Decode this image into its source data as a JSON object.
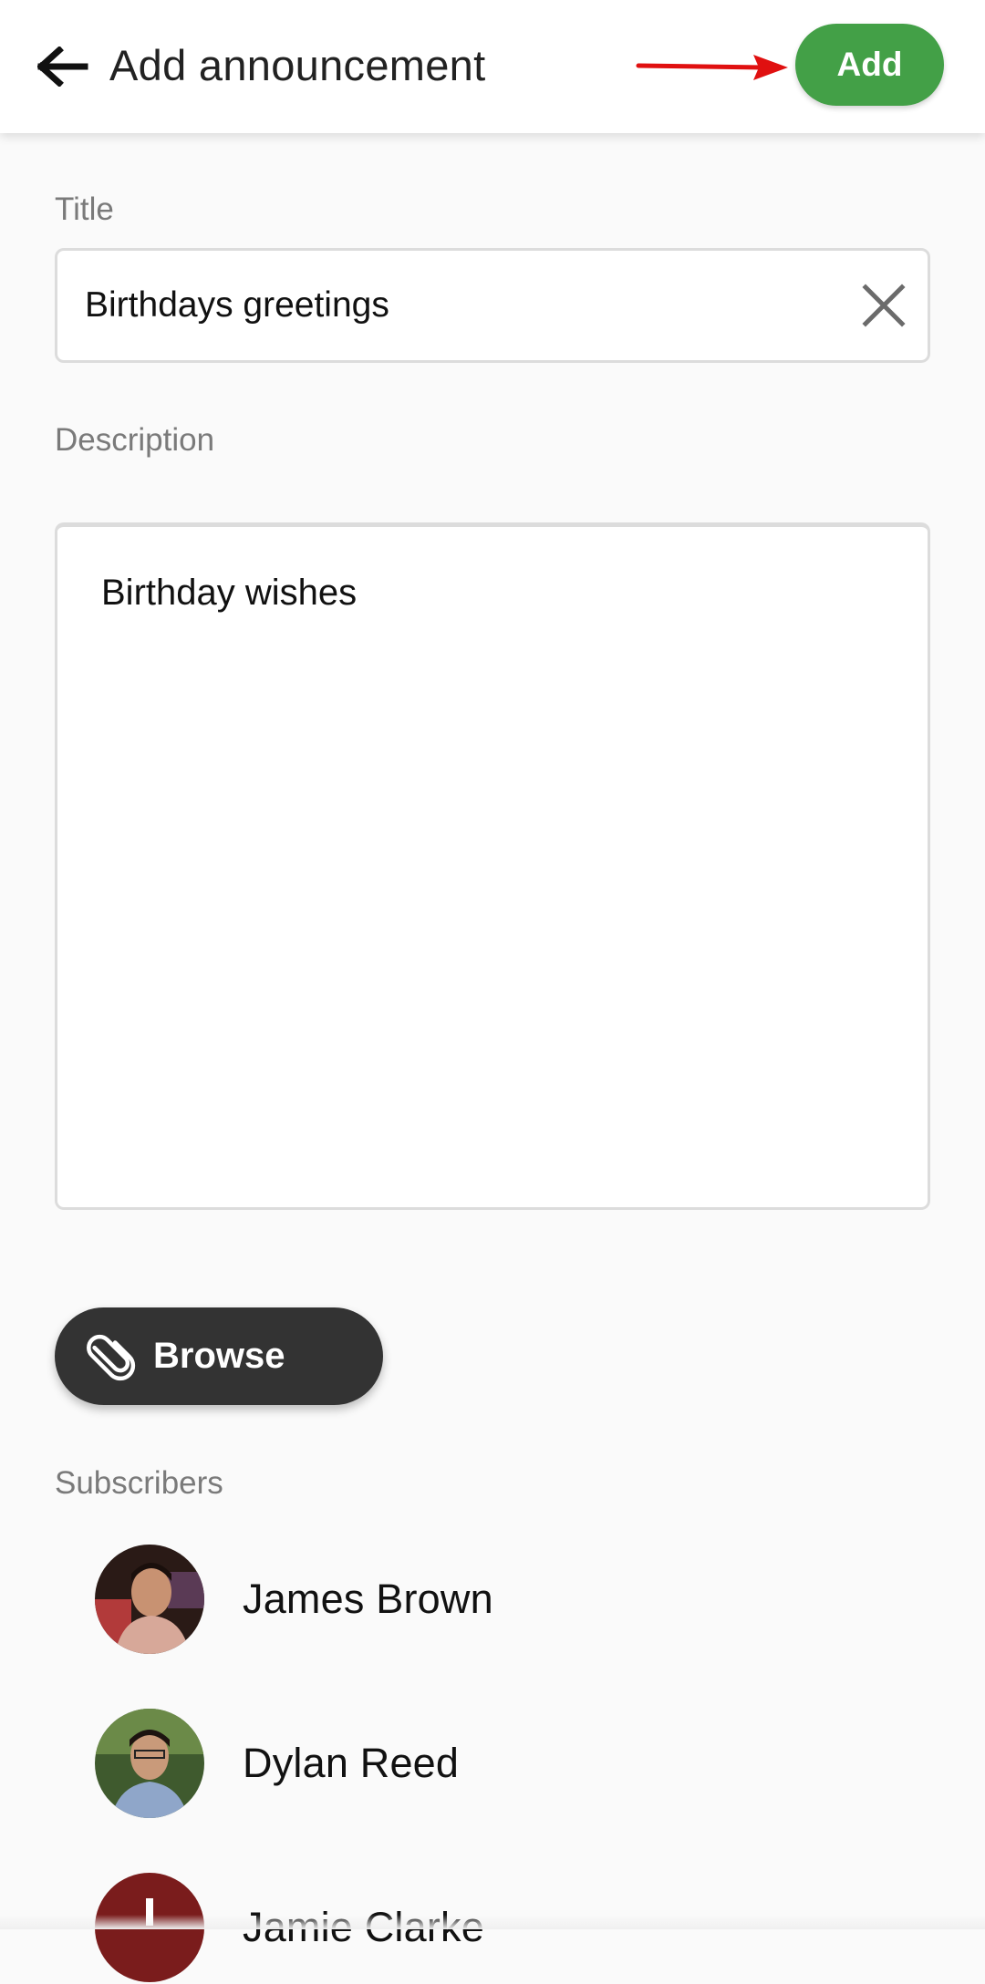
{
  "appbar": {
    "back_icon": "arrow-left-icon",
    "title": "Add announcement",
    "add_label": "Add",
    "add_color": "#43a047"
  },
  "form": {
    "title_label": "Title",
    "title_value": "Birthdays greetings",
    "clear_icon": "close-icon",
    "description_label": "Description",
    "description_value": "Birthday wishes",
    "browse_label": "Browse",
    "browse_icon": "paperclip-icon"
  },
  "subscribers": {
    "label": "Subscribers",
    "items": [
      {
        "name": "James Brown",
        "avatar": "photo-avatar"
      },
      {
        "name": "Dylan Reed",
        "avatar": "photo-avatar"
      },
      {
        "name": "Jamie Clarke",
        "avatar": "initial-avatar",
        "initial": "J",
        "color": "#7a1c1c"
      }
    ]
  },
  "annotation": {
    "arrow_color": "#e01010"
  }
}
